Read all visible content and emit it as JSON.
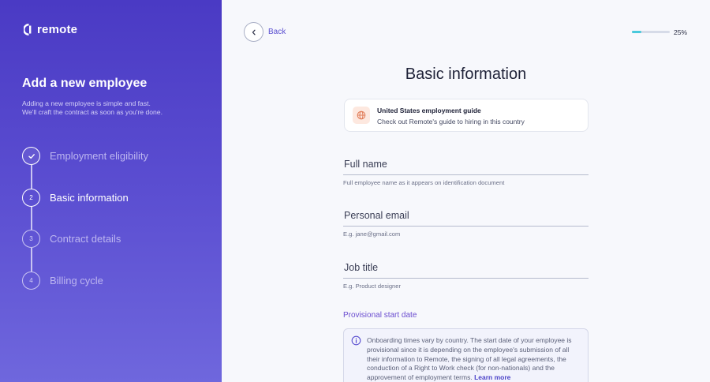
{
  "brand": {
    "name": "remote"
  },
  "sidebar": {
    "title": "Add a new employee",
    "description_line1": "Adding a new employee is simple and fast.",
    "description_line2": "We'll craft the contract as soon as you're done.",
    "steps": [
      {
        "number": "",
        "label": "Employment eligibility",
        "state": "done",
        "icon": "check-icon"
      },
      {
        "number": "2",
        "label": "Basic information",
        "state": "active"
      },
      {
        "number": "3",
        "label": "Contract details",
        "state": "upcoming"
      },
      {
        "number": "4",
        "label": "Billing cycle",
        "state": "upcoming"
      }
    ]
  },
  "header": {
    "back_label": "Back",
    "progress_percent": 25,
    "progress_text": "25%"
  },
  "main": {
    "title": "Basic information",
    "guide": {
      "title": "United States employment guide",
      "subtitle": "Check out Remote's guide to hiring in this country",
      "icon": "globe-icon"
    },
    "fields": [
      {
        "label": "Full name",
        "help": "Full employee name as it appears on identification document"
      },
      {
        "label": "Personal email",
        "help": "E.g. jane@gmail.com"
      },
      {
        "label": "Job title",
        "help": "E.g. Product designer"
      }
    ],
    "start_date_section": {
      "title": "Provisional start date",
      "info_text": "Onboarding times vary by country. The start date of your employee is provisional since it is depending on the employee's submission of all their information to Remote, the signing of all legal agreements, the conduction of a Right to Work check (for non-nationals) and the approvement of employment terms.",
      "link_label": "Learn more"
    }
  },
  "colors": {
    "sidebar_gradient_top": "#4a3ac4",
    "sidebar_gradient_bottom": "#6f67dd",
    "accent": "#5a4fd0",
    "progress": "#49c9dc"
  }
}
